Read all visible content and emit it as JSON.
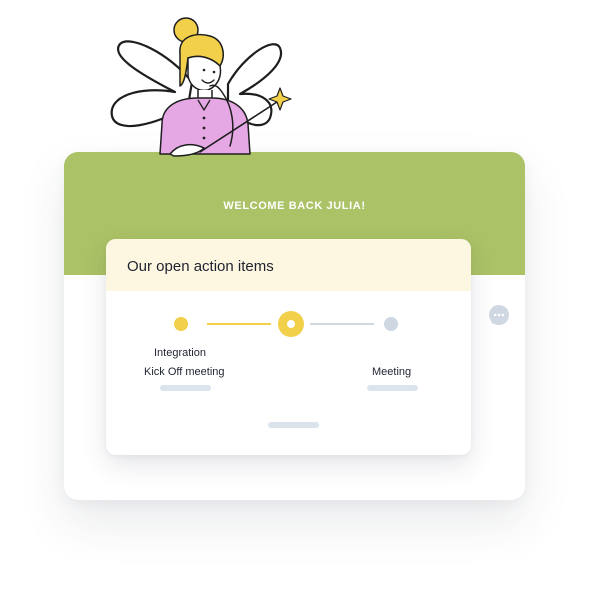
{
  "banner": {
    "welcome_text": "WELCOME BACK JULIA!"
  },
  "action_items": {
    "title": "Our open action items",
    "steps": [
      {
        "label": "Integration",
        "status": "done"
      },
      {
        "label": "Kick Off meeting",
        "status": "current"
      },
      {
        "label": "Meeting",
        "status": "upcoming"
      }
    ]
  },
  "icons": {
    "chat": "chat-bubble-icon",
    "illustration": "fairy-illustration"
  },
  "colors": {
    "banner_green": "#abc266",
    "progress_yellow": "#f2d04a",
    "progress_grey": "#cfd7e2",
    "header_cream": "#fdf6e1",
    "fairy_shirt": "#e5a8e4"
  }
}
